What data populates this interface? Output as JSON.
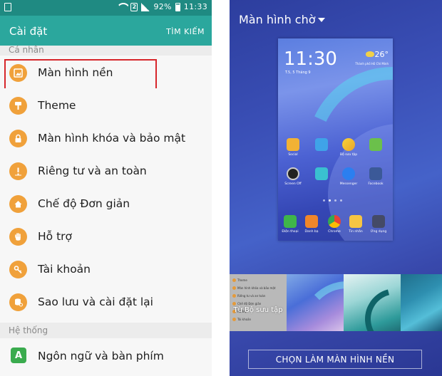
{
  "status_bar": {
    "battery_percent": "92%",
    "time": "11:33",
    "sim_label": "2"
  },
  "settings": {
    "title": "Cài đặt",
    "search_label": "TÌM KIẾM",
    "section_personal": "Cá nhân",
    "items": [
      {
        "label": "Màn hình nền",
        "icon": "wallpaper-icon"
      },
      {
        "label": "Theme",
        "icon": "paintbrush-icon"
      },
      {
        "label": "Màn hình khóa và bảo mật",
        "icon": "lock-icon"
      },
      {
        "label": "Riêng tư và an toàn",
        "icon": "privacy-icon"
      },
      {
        "label": "Chế độ Đơn giản",
        "icon": "home-icon"
      },
      {
        "label": "Hỗ trợ",
        "icon": "hand-icon"
      },
      {
        "label": "Tài khoản",
        "icon": "key-icon"
      },
      {
        "label": "Sao lưu và cài đặt lại",
        "icon": "backup-icon"
      }
    ],
    "section_system": "Hệ thống",
    "system_items": [
      {
        "label": "Ngôn ngữ và bàn phím",
        "icon": "language-icon",
        "glyph": "A"
      }
    ],
    "selected_index": 0
  },
  "wallpaper": {
    "screen_selector": "Màn hình chờ",
    "preview": {
      "clock": "11:30",
      "date": "T.5, 5 Tháng 9",
      "temperature": "26°",
      "location": "Thành phố Hồ Chí Minh",
      "apps_row1": [
        "Social",
        "",
        "Bộ sưu tập",
        ""
      ],
      "apps_row2": [
        "Screen Off",
        "",
        "Messenger",
        "Facebook"
      ],
      "dock": [
        "Điện thoại",
        "Danh bạ",
        "Chrome",
        "Tin nhắn",
        "Ứng dụng"
      ]
    },
    "gallery_mini_items": [
      "Theme",
      "Màn hình khóa và bảo mật",
      "Riêng tư và an toàn",
      "Chế độ Đơn giản",
      "Hỗ trợ",
      "Tài khoản"
    ],
    "gallery_caption": "Từ Bộ sưu tập",
    "apply_button": "CHỌN LÀM MÀN HÌNH NỀN"
  }
}
